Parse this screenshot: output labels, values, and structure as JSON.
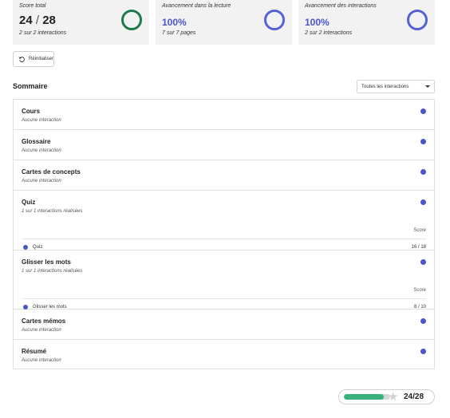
{
  "cards": [
    {
      "title": "Score total",
      "value_main": "24",
      "value_sep": "/",
      "value_total": "28",
      "subtitle": "2 sur 2 interactions",
      "ring_color": "#1e7a4a"
    },
    {
      "title": "Avancement dans la lecture",
      "value": "100%",
      "subtitle": "7 sur 7 pages",
      "ring_color": "#5661d6"
    },
    {
      "title": "Avancement des interactions",
      "value": "100%",
      "subtitle": "2 sur 2 interactions",
      "ring_color": "#5661d6"
    }
  ],
  "reset_label": "Réinitialiser",
  "summary": {
    "title": "Sommaire",
    "filter_value": "Toutes les interactions"
  },
  "sections": [
    {
      "title": "Cours",
      "subtitle": "Aucune interaction"
    },
    {
      "title": "Glossaire",
      "subtitle": "Aucune interaction"
    },
    {
      "title": "Cartes de concepts",
      "subtitle": "Aucune interaction"
    },
    {
      "title": "Quiz",
      "subtitle": "1 sur 1 interactions réalisées",
      "score_label": "Score",
      "sub_item": {
        "label": "Quiz",
        "score": "16 / 18"
      }
    },
    {
      "title": "Glisser les mots",
      "subtitle": "1 sur 1 interactions réalisées",
      "score_label": "Score",
      "sub_item": {
        "label": "Glisser les mots",
        "score": "8 / 10"
      }
    },
    {
      "title": "Cartes mémos",
      "subtitle": "Aucune interaction"
    },
    {
      "title": "Résumé",
      "subtitle": "Aucune interaction"
    }
  ],
  "progress": {
    "score_text": "24/28",
    "fraction": 0.857,
    "fill_color": "#3ab07e"
  },
  "colors": {
    "accent": "#4a56c8",
    "success": "#1e7a4a"
  }
}
